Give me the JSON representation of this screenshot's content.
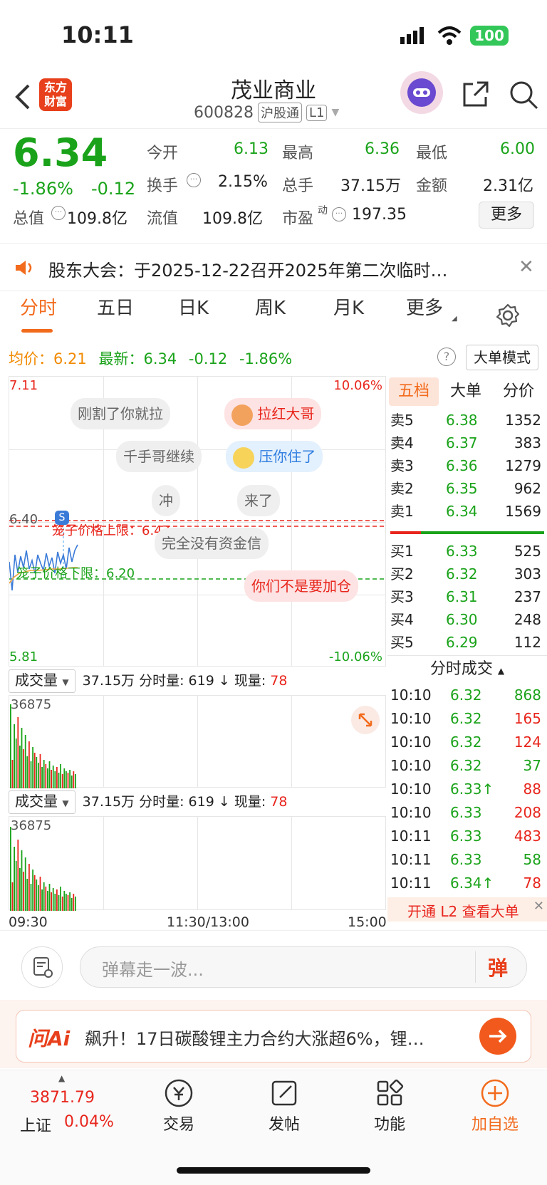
{
  "status": {
    "time": "10:11",
    "battery": "100"
  },
  "header": {
    "logo_line1": "东方",
    "logo_line2": "财富",
    "title": "茂业商业",
    "code": "600828",
    "tag1": "沪股通",
    "tag2": "L1"
  },
  "quote": {
    "price": "6.34",
    "pct": "-1.86%",
    "chg": "-0.12",
    "labels": {
      "open": "今开",
      "high": "最高",
      "low": "最低",
      "turnover": "换手",
      "volume": "总手",
      "amount": "金额",
      "mktcap": "总值",
      "float": "流值",
      "pe": "市盈",
      "pe_sup": "动"
    },
    "open": "6.13",
    "high": "6.36",
    "low": "6.00",
    "turnover": "2.15%",
    "volume": "37.15万",
    "amount": "2.31亿",
    "mktcap": "109.8亿",
    "float": "109.8亿",
    "pe": "197.35",
    "more": "更多"
  },
  "notice": {
    "text": "股东大会：于2025-12-22召开2025年第二次临时…"
  },
  "tabs": {
    "t1": "分时",
    "t2": "五日",
    "t3": "日K",
    "t4": "周K",
    "t5": "月K",
    "t6": "更多"
  },
  "avgline": {
    "avg_label": "均价：",
    "avg": "6.21",
    "latest_label": "最新：",
    "latest": "6.34",
    "chg": "-0.12",
    "pct": "-1.86%",
    "mode": "大单模式"
  },
  "chart": {
    "y_top": "7.11",
    "y_bottom": "5.81",
    "pct_top": "10.06%",
    "pct_bottom": "-10.06%",
    "y_mid": "6.40",
    "upper_label": "笼子价格上限：6.47",
    "lower_label": "笼子价格下限：6.20",
    "badge": "S"
  },
  "danmu": {
    "d1": "刚割了你就拉",
    "d2": "拉红大哥",
    "d3": "千手哥继续",
    "d4": "压你住了",
    "d5": "冲",
    "d6": "来了",
    "d7": "完全没有资金信",
    "d8": "你们不是要加仓"
  },
  "volume_panel": {
    "selector": "成交量",
    "total": "37.15万",
    "seg_label": "分时量:",
    "seg": "619",
    "arrow": "↓",
    "now_label": "现量:",
    "now": "78",
    "max": "36875"
  },
  "time_axis": {
    "start": "09:30",
    "mid": "11:30/13:00",
    "end": "15:00"
  },
  "orderbook": {
    "tabs": {
      "a": "五档",
      "b": "大单",
      "c": "分价"
    },
    "sells": [
      {
        "label": "卖5",
        "price": "6.38",
        "vol": "1352"
      },
      {
        "label": "卖4",
        "price": "6.37",
        "vol": "383"
      },
      {
        "label": "卖3",
        "price": "6.36",
        "vol": "1279"
      },
      {
        "label": "卖2",
        "price": "6.35",
        "vol": "962"
      },
      {
        "label": "卖1",
        "price": "6.34",
        "vol": "1569"
      }
    ],
    "buys": [
      {
        "label": "买1",
        "price": "6.33",
        "vol": "525"
      },
      {
        "label": "买2",
        "price": "6.32",
        "vol": "303"
      },
      {
        "label": "买3",
        "price": "6.31",
        "vol": "237"
      },
      {
        "label": "买4",
        "price": "6.30",
        "vol": "248"
      },
      {
        "label": "买5",
        "price": "6.29",
        "vol": "112"
      }
    ],
    "trades_title": "分时成交",
    "trades": [
      {
        "time": "10:10",
        "price": "6.32",
        "vol": "868"
      },
      {
        "time": "10:10",
        "price": "6.32",
        "vol": "165"
      },
      {
        "time": "10:10",
        "price": "6.32",
        "vol": "124"
      },
      {
        "time": "10:10",
        "price": "6.32",
        "vol": "37"
      },
      {
        "time": "10:10",
        "price": "6.33↑",
        "vol": "88"
      },
      {
        "time": "10:10",
        "price": "6.33",
        "vol": "208"
      },
      {
        "time": "10:11",
        "price": "6.33",
        "vol": "483"
      },
      {
        "time": "10:11",
        "price": "6.33",
        "vol": "58"
      },
      {
        "time": "10:11",
        "price": "6.34↑",
        "vol": "78"
      }
    ],
    "l2": "开通 L2 查看大单"
  },
  "comment": {
    "placeholder": "弹幕走一波...",
    "danmu_btn": "弹"
  },
  "ai_banner": {
    "logo": "问Ai",
    "text": "飙升！17日碳酸锂主力合约大涨超6%，锂…"
  },
  "bottom": {
    "index_value": "3871.79",
    "index_name": "上证",
    "index_pct": "0.04%",
    "trade": "交易",
    "post": "发帖",
    "func": "功能",
    "add": "加自选"
  }
}
